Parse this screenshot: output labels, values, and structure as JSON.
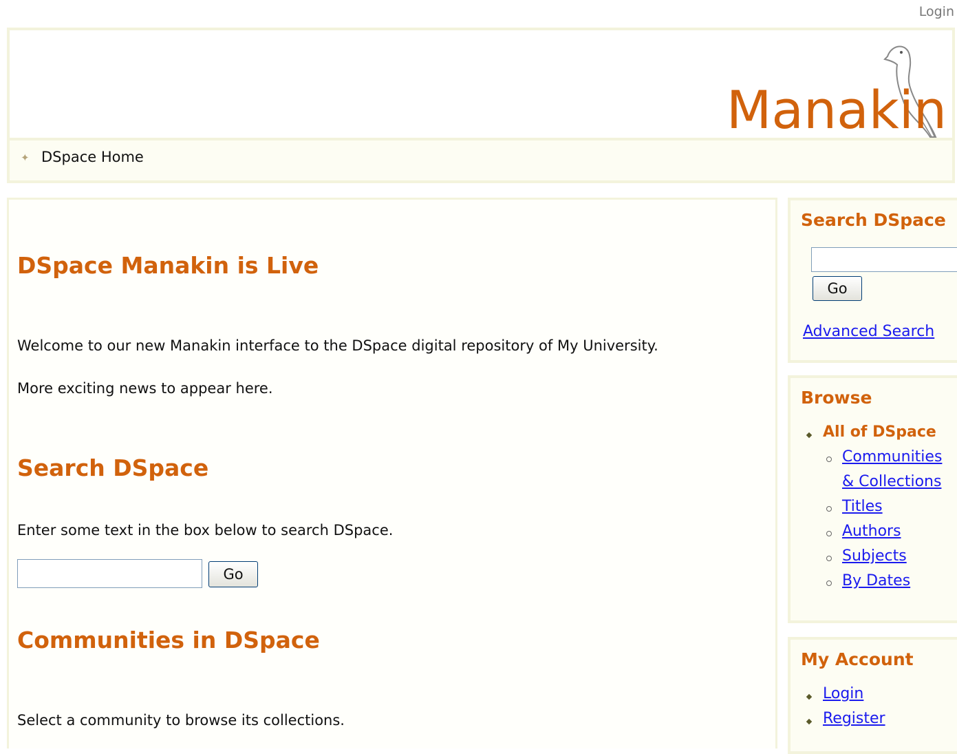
{
  "top_login": "Login",
  "header": {
    "logo_text": "Manakin",
    "trail_label": "DSpace Home"
  },
  "main": {
    "news_title": "DSpace Manakin is Live",
    "news_p1": "Welcome to our new Manakin interface to the DSpace digital repository of My University.",
    "news_p2": "More exciting news to appear here.",
    "search_title": "Search DSpace",
    "search_text": "Enter some text in the box below to search DSpace.",
    "search_value": "",
    "go_label": "Go",
    "communities_title": "Communities in DSpace",
    "communities_text": "Select a community to browse its collections."
  },
  "sidebar": {
    "search": {
      "title": "Search DSpace",
      "value": "",
      "go_label": "Go",
      "advanced_label": "Advanced Search"
    },
    "browse": {
      "title": "Browse",
      "all_label": "All of DSpace",
      "items": [
        {
          "label": "Communities"
        },
        {
          "label": "& Collections"
        },
        {
          "label": "Titles"
        },
        {
          "label": "Authors"
        },
        {
          "label": "Subjects"
        },
        {
          "label": "By Dates"
        }
      ]
    },
    "account": {
      "title": "My Account",
      "items": [
        {
          "label": "Login"
        },
        {
          "label": "Register"
        }
      ]
    }
  },
  "colors": {
    "accent": "#d1620c",
    "link": "#1a1aee",
    "border": "#f3f3dc",
    "panel_bg": "#fdfdf3"
  },
  "icons": {
    "trail": "diamond-arrow-icon",
    "logo": "bird-icon"
  }
}
